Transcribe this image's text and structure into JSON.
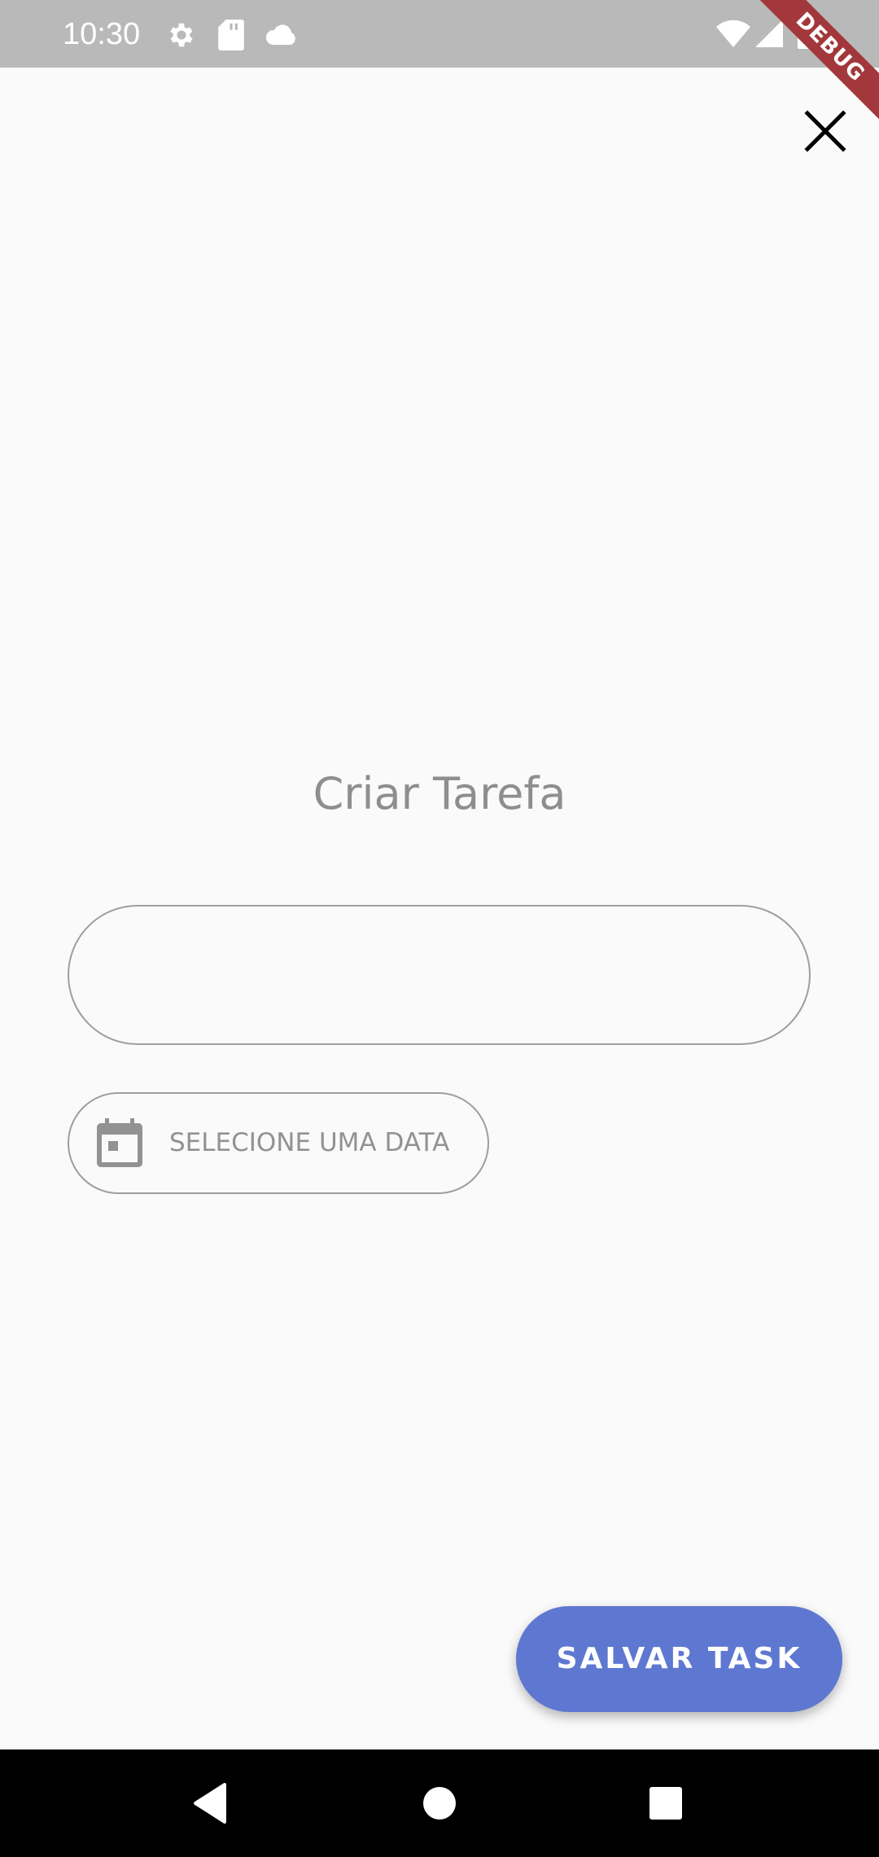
{
  "status_bar": {
    "time": "10:30",
    "icons": [
      "settings-icon",
      "sd-card-icon",
      "cloud-icon",
      "wifi-icon",
      "signal-icon",
      "battery-icon"
    ]
  },
  "debug_banner": "DEBUG",
  "header": {
    "close_icon": "close-icon"
  },
  "form": {
    "title": "Criar Tarefa",
    "task_input_value": "",
    "task_input_placeholder": "",
    "date_button_label": "SELECIONE UMA DATA",
    "date_icon": "calendar-icon"
  },
  "actions": {
    "save_label": "SALVAR TASK"
  },
  "nav": {
    "back_icon": "back-icon",
    "home_icon": "home-icon",
    "recents_icon": "recents-icon"
  },
  "colors": {
    "status_bar": "#b9b9b9",
    "background": "#fafafa",
    "accent": "#5e78d1",
    "muted_text": "#8e8e8e",
    "outline": "#9e9e9e",
    "debug_ribbon": "#a2383b"
  }
}
